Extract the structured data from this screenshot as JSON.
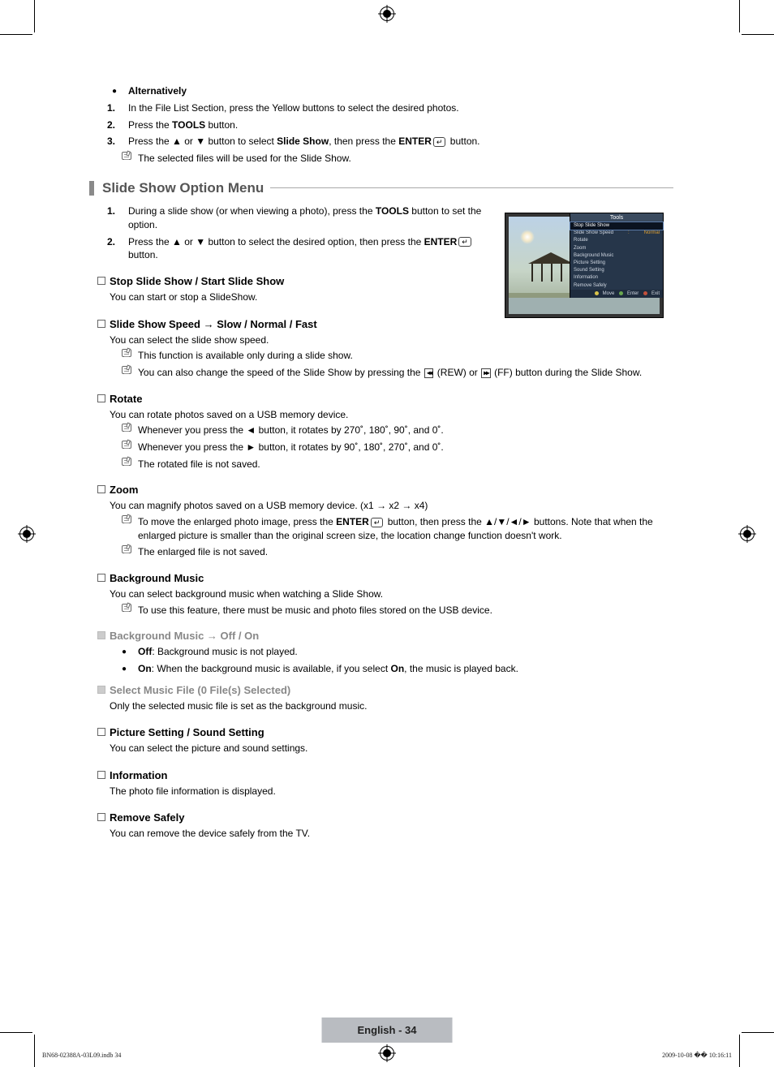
{
  "alt": {
    "heading": "Alternatively",
    "step1": "In the File List Section, press the Yellow buttons to select the desired photos.",
    "step2_a": "Press the ",
    "step2_b": "TOOLS",
    "step2_c": " button.",
    "step3_a": "Press the ▲ or ▼ button to select ",
    "step3_b": "Slide Show",
    "step3_c": ", then press the ",
    "step3_d": "ENTER",
    "step3_e": " button.",
    "note": "The selected files will be used for the Slide Show."
  },
  "section": {
    "title": "Slide Show Option Menu"
  },
  "intro": {
    "step1_a": "During a slide show (or when viewing a photo), press the ",
    "step1_b": "TOOLS",
    "step1_c": " button to set the option.",
    "step2_a": "Press the ▲ or ▼ button to select the desired option, then press the ",
    "step2_b": "ENTER",
    "step2_c": " button."
  },
  "stopstart": {
    "heading": "Stop Slide Show / Start Slide Show",
    "body": "You can start or stop a SlideShow."
  },
  "speed": {
    "heading": "Slide Show Speed → Slow / Normal / Fast",
    "body": "You can select the slide show speed.",
    "note1": "This function is available only during a slide show.",
    "note2_a": "You can also change the speed of the Slide Show by pressing the ",
    "note2_b": " (REW) or ",
    "note2_c": " (FF) button during the Slide Show."
  },
  "rotate": {
    "heading": "Rotate",
    "body": "You can rotate photos saved on a USB memory device.",
    "note1": "Whenever you press the ◄ button, it rotates by 270˚, 180˚, 90˚, and 0˚.",
    "note2": "Whenever you press the ► button, it rotates by 90˚, 180˚, 270˚, and 0˚.",
    "note3": "The rotated file is not saved."
  },
  "zoom": {
    "heading": "Zoom",
    "body": "You can magnify photos saved on a USB memory device. (x1 → x2 → x4)",
    "note1_a": "To move the enlarged photo image, press the ",
    "note1_b": "ENTER",
    "note1_c": " button, then press the ▲/▼/◄/► buttons. Note that when the enlarged picture is smaller than the original screen size, the location change function doesn't work.",
    "note2": "The enlarged file is not saved."
  },
  "bgm": {
    "heading": "Background Music",
    "body": "You can select background music when watching a Slide Show.",
    "note1": "To use this feature, there must be music and photo files stored on the USB device.",
    "sub1_heading": "Background Music → Off / On",
    "sub1_off_b": "Off",
    "sub1_off_rest": ": Background music is not played.",
    "sub1_on_b": "On",
    "sub1_on_mid": ": When the background music is available, if you select ",
    "sub1_on_b2": "On",
    "sub1_on_rest": ", the music is played back.",
    "sub2_heading": "Select Music File (0 File(s) Selected)",
    "sub2_body": "Only the selected music file is set as the background music."
  },
  "picsound": {
    "heading": "Picture Setting / Sound Setting",
    "body": "You can select the picture and sound settings."
  },
  "info": {
    "heading": "Information",
    "body": "The photo file information is displayed."
  },
  "remove": {
    "heading": "Remove Safely",
    "body": "You can remove the device safely from the TV."
  },
  "osd": {
    "title": "Tools",
    "items": [
      {
        "label": "Stop Slide Show",
        "val": ""
      },
      {
        "label": "Slide Show Speed",
        "val": "Normal"
      },
      {
        "label": "Rotate",
        "val": ""
      },
      {
        "label": "Zoom",
        "val": ""
      },
      {
        "label": "Background Music",
        "val": ""
      },
      {
        "label": "Picture Setting",
        "val": ""
      },
      {
        "label": "Sound Setting",
        "val": ""
      },
      {
        "label": "Information",
        "val": ""
      },
      {
        "label": "Remove Safely",
        "val": ""
      }
    ],
    "btn_move": "Move",
    "btn_enter": "Enter",
    "btn_exit": "Exit"
  },
  "footer": {
    "page": "English - 34"
  },
  "docid": "BN68-02388A-03L09.indb   34",
  "docts": "2009-10-08   �� 10:16:11"
}
